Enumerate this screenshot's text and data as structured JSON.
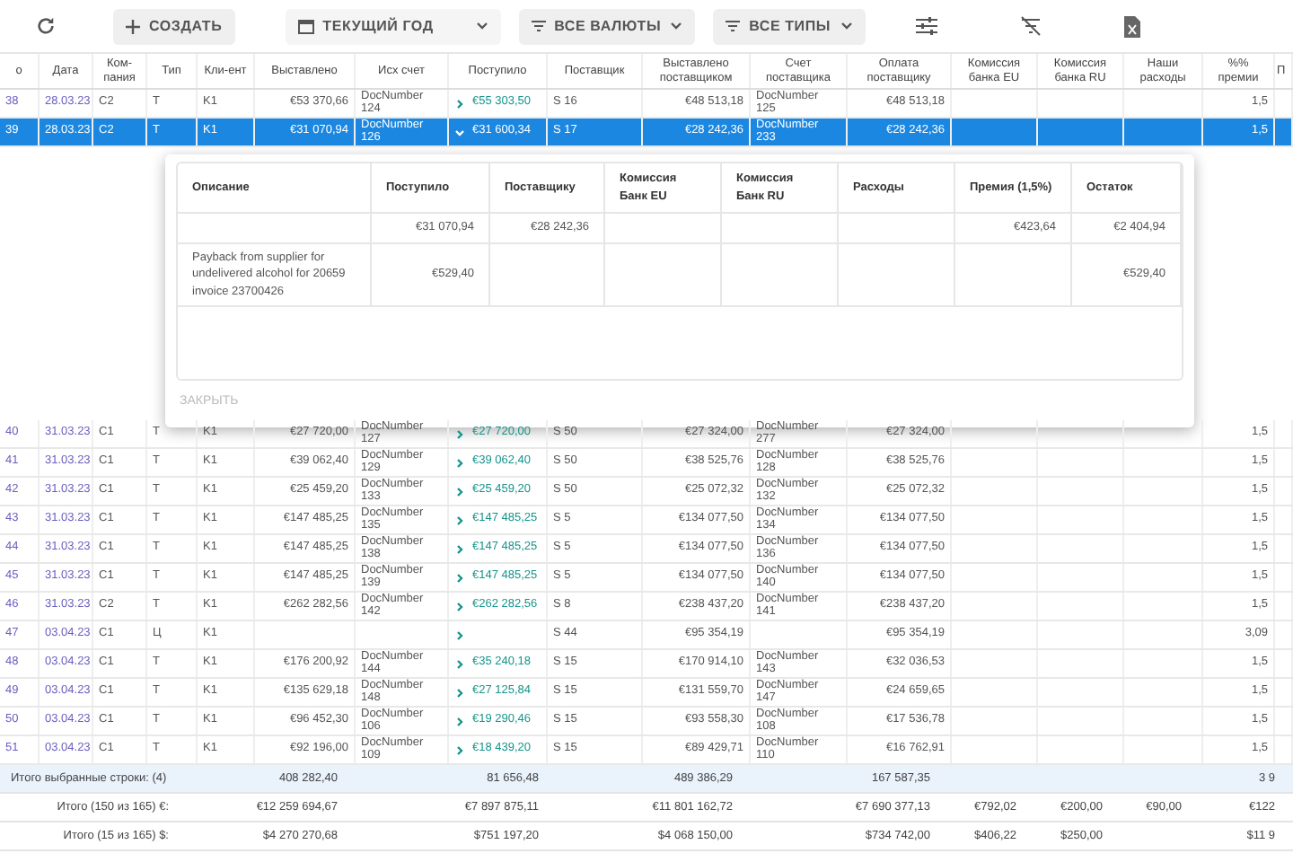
{
  "toolbar": {
    "create": "СОЗДАТЬ",
    "period": "ТЕКУЩИЙ ГОД",
    "currency": "ВСЕ ВАЛЮТЫ",
    "types": "ВСЕ ТИПЫ"
  },
  "table": {
    "columns": [
      "о",
      "Дата",
      "Ком-пания",
      "Тип",
      "Кли-ент",
      "Выставлено",
      "Исх счет",
      "Поступило",
      "Поставщик",
      "Выставлено поставщиком",
      "Счет поставщика",
      "Оплата поставщику",
      "Комиссия банка EU",
      "Комиссия банка RU",
      "Наши расходы",
      "%% премии",
      "П"
    ],
    "rows": [
      {
        "number": "38",
        "date": "28.03.23",
        "company": "C2",
        "type": "T",
        "client": "K1",
        "invoiced": "€53 370,66",
        "invoice_doc": "DocNumber 124",
        "received": "€55 303,50",
        "supplier": "S 16",
        "supplier_invoiced": "€48 513,18",
        "supplier_doc": "DocNumber 125",
        "supplier_paid": "€48 513,18",
        "bonus_pct": "1,5",
        "selected": false,
        "expanded": false
      },
      {
        "number": "39",
        "date": "28.03.23",
        "company": "C2",
        "type": "T",
        "client": "K1",
        "invoiced": "€31 070,94",
        "invoice_doc": "DocNumber 126",
        "received": "€31 600,34",
        "supplier": "S 17",
        "supplier_invoiced": "€28 242,36",
        "supplier_doc": "DocNumber 233",
        "supplier_paid": "€28 242,36",
        "bonus_pct": "1,5",
        "selected": true,
        "expanded": true
      },
      {
        "number": "40",
        "date": "31.03.23",
        "company": "C1",
        "type": "T",
        "client": "K1",
        "invoiced": "€27 720,00",
        "invoice_doc": "DocNumber 127",
        "received": "€27 720,00",
        "supplier": "S 50",
        "supplier_invoiced": "€27 324,00",
        "supplier_doc": "DocNumber 277",
        "supplier_paid": "€27 324,00",
        "bonus_pct": "1,5",
        "selected": false,
        "expanded": false
      },
      {
        "number": "41",
        "date": "31.03.23",
        "company": "C1",
        "type": "T",
        "client": "K1",
        "invoiced": "€39 062,40",
        "invoice_doc": "DocNumber 129",
        "received": "€39 062,40",
        "supplier": "S 50",
        "supplier_invoiced": "€38 525,76",
        "supplier_doc": "DocNumber 128",
        "supplier_paid": "€38 525,76",
        "bonus_pct": "1,5",
        "selected": false,
        "expanded": false
      },
      {
        "number": "42",
        "date": "31.03.23",
        "company": "C1",
        "type": "T",
        "client": "K1",
        "invoiced": "€25 459,20",
        "invoice_doc": "DocNumber 133",
        "received": "€25 459,20",
        "supplier": "S 50",
        "supplier_invoiced": "€25 072,32",
        "supplier_doc": "DocNumber 132",
        "supplier_paid": "€25 072,32",
        "bonus_pct": "1,5",
        "selected": false,
        "expanded": false
      },
      {
        "number": "43",
        "date": "31.03.23",
        "company": "C1",
        "type": "T",
        "client": "K1",
        "invoiced": "€147 485,25",
        "invoice_doc": "DocNumber 135",
        "received": "€147 485,25",
        "supplier": "S 5",
        "supplier_invoiced": "€134 077,50",
        "supplier_doc": "DocNumber 134",
        "supplier_paid": "€134 077,50",
        "bonus_pct": "1,5",
        "selected": false,
        "expanded": false
      },
      {
        "number": "44",
        "date": "31.03.23",
        "company": "C1",
        "type": "T",
        "client": "K1",
        "invoiced": "€147 485,25",
        "invoice_doc": "DocNumber 138",
        "received": "€147 485,25",
        "supplier": "S 5",
        "supplier_invoiced": "€134 077,50",
        "supplier_doc": "DocNumber 136",
        "supplier_paid": "€134 077,50",
        "bonus_pct": "1,5",
        "selected": false,
        "expanded": false
      },
      {
        "number": "45",
        "date": "31.03.23",
        "company": "C1",
        "type": "T",
        "client": "K1",
        "invoiced": "€147 485,25",
        "invoice_doc": "DocNumber 139",
        "received": "€147 485,25",
        "supplier": "S 5",
        "supplier_invoiced": "€134 077,50",
        "supplier_doc": "DocNumber 140",
        "supplier_paid": "€134 077,50",
        "bonus_pct": "1,5",
        "selected": false,
        "expanded": false
      },
      {
        "number": "46",
        "date": "31.03.23",
        "company": "C2",
        "type": "T",
        "client": "K1",
        "invoiced": "€262 282,56",
        "invoice_doc": "DocNumber 142",
        "received": "€262 282,56",
        "supplier": "S 8",
        "supplier_invoiced": "€238 437,20",
        "supplier_doc": "DocNumber 141",
        "supplier_paid": "€238 437,20",
        "bonus_pct": "1,5",
        "selected": false,
        "expanded": false
      },
      {
        "number": "47",
        "date": "03.04.23",
        "company": "C1",
        "type": "Ц",
        "client": "K1",
        "supplier": "S 44",
        "supplier_invoiced": "€95 354,19",
        "supplier_paid": "€95 354,19",
        "bonus_pct": "3,09",
        "selected": false,
        "expanded": false
      },
      {
        "number": "48",
        "date": "03.04.23",
        "company": "C1",
        "type": "T",
        "client": "K1",
        "invoiced": "€176 200,92",
        "invoice_doc": "DocNumber 144",
        "received": "€35 240,18",
        "supplier": "S 15",
        "supplier_invoiced": "€170 914,10",
        "supplier_doc": "DocNumber 143",
        "supplier_paid": "€32 036,53",
        "bonus_pct": "1,5",
        "selected": false,
        "expanded": false
      },
      {
        "number": "49",
        "date": "03.04.23",
        "company": "C1",
        "type": "T",
        "client": "K1",
        "invoiced": "€135 629,18",
        "invoice_doc": "DocNumber 148",
        "received": "€27 125,84",
        "supplier": "S 15",
        "supplier_invoiced": "€131 559,70",
        "supplier_doc": "DocNumber 147",
        "supplier_paid": "€24 659,65",
        "bonus_pct": "1,5",
        "selected": false,
        "expanded": false
      },
      {
        "number": "50",
        "date": "03.04.23",
        "company": "C1",
        "type": "T",
        "client": "K1",
        "invoiced": "€96 452,30",
        "invoice_doc": "DocNumber 106",
        "received": "€19 290,46",
        "supplier": "S 15",
        "supplier_invoiced": "€93 558,30",
        "supplier_doc": "DocNumber 108",
        "supplier_paid": "€17 536,78",
        "bonus_pct": "1,5",
        "selected": false,
        "expanded": false
      },
      {
        "number": "51",
        "date": "03.04.23",
        "company": "C1",
        "type": "T",
        "client": "K1",
        "invoiced": "€92 196,00",
        "invoice_doc": "DocNumber 109",
        "received": "€18 439,20",
        "supplier": "S 15",
        "supplier_invoiced": "€89 429,71",
        "supplier_doc": "DocNumber 110",
        "supplier_paid": "€16 762,91",
        "bonus_pct": "1,5",
        "selected": false,
        "expanded": false
      }
    ]
  },
  "detail": {
    "columns": [
      "Описание",
      "Поступило",
      "Поставщику",
      "Комиссия Банк EU",
      "Комиссия Банк RU",
      "Расходы",
      "Премия (1,5%)",
      "Остаток"
    ],
    "rows": [
      [
        "",
        "€31 070,94",
        "€28 242,36",
        "",
        "",
        "",
        "€423,64",
        "€2 404,94"
      ],
      [
        "Payback from supplier for undelivered alcohol for 20659 invoice 23700426",
        "€529,40",
        "",
        "",
        "",
        "",
        "",
        "€529,40"
      ]
    ],
    "close": "ЗАКРЫТЬ"
  },
  "totals": [
    {
      "label": "Итого выбранные строки: (4)",
      "highlighted": true,
      "values": {
        "invoiced": "408 282,40",
        "received": "81 656,48",
        "supplier_invoiced": "489 386,29",
        "supplier_paid": "167 587,35",
        "column_9": "3 9"
      }
    },
    {
      "label": "Итого (150 из 165) €:",
      "highlighted": false,
      "values": {
        "invoiced": "€12 259 694,67",
        "received": "€7 897 875,11",
        "supplier_invoiced": "€11 801 162,72",
        "supplier_paid": "€7 690 377,13",
        "commission_eu": "€792,02",
        "commission_ru": "€200,00",
        "expenses": "€90,00",
        "column_9": "€122"
      }
    },
    {
      "label": "Итого (15 из 165) $:",
      "highlighted": false,
      "values": {
        "invoiced": "$4 270 270,68",
        "received": "$751 197,20",
        "supplier_invoiced": "$4 068 150,00",
        "supplier_paid": "$734 742,00",
        "commission_eu": "$406,22",
        "commission_ru": "$250,00",
        "column_9": "$11 9"
      }
    }
  ]
}
